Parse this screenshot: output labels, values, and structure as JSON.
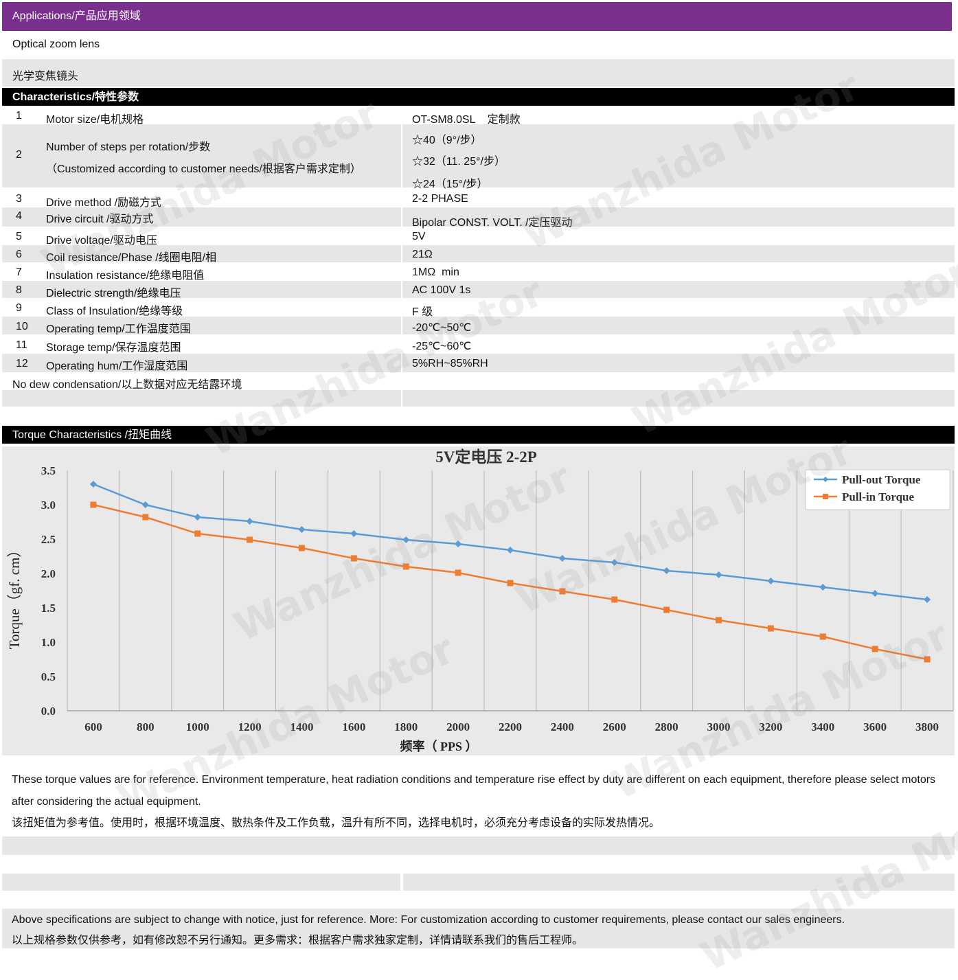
{
  "applications": {
    "header": "Applications/产品应用领域",
    "line_en": "Optical zoom lens",
    "line_cn": "光学变焦镜头"
  },
  "characteristics": {
    "header": "Characteristics/特性参数",
    "rows": [
      {
        "num": "1",
        "name": "Motor size/电机规格",
        "value": "OT-SM8.0SL    定制款"
      },
      {
        "num": "2",
        "name": "Number of steps per rotation/步数",
        "name2": "（Customized according to customer needs/根据客户需求定制）",
        "values": [
          "☆40（9°/步）",
          "☆32（11. 25°/步）",
          "☆24（15°/步）"
        ]
      },
      {
        "num": "3",
        "name": "Drive method /励磁方式",
        "value": "2-2 PHASE"
      },
      {
        "num": "4",
        "name": "Drive circuit /驱动方式",
        "value": "Bipolar CONST. VOLT. /定压驱动"
      },
      {
        "num": "5",
        "name": "Drive voltage/驱动电压",
        "value": "5V"
      },
      {
        "num": "6",
        "name": "Coil resistance/Phase /线圈电阻/相",
        "value": "21Ω"
      },
      {
        "num": "7",
        "name": "Insulation resistance/绝缘电阻值",
        "value": "1MΩ  min"
      },
      {
        "num": "8",
        "name": "Dielectric strength/绝缘电压",
        "value": "AC 100V 1s"
      },
      {
        "num": "9",
        "name": "Class of Insulation/绝缘等级",
        "value": "F 级"
      },
      {
        "num": "10",
        "name": "Operating temp/工作温度范围",
        "value": "-20℃~50℃"
      },
      {
        "num": "11",
        "name": "Storage temp/保存温度范围",
        "value": "-25℃~60℃"
      },
      {
        "num": "12",
        "name": "Operating hum/工作湿度范围",
        "value": "5%RH~85%RH"
      }
    ],
    "note": "No dew condensation/以上数据对应无结露环境"
  },
  "torque": {
    "header": "Torque Characteristics /扭矩曲线",
    "note_en": "These torque values are for reference. Environment temperature, heat radiation conditions and temperature rise effect by duty are different on each equipment, therefore please select motors after considering the actual equipment.",
    "note_cn": "该扭矩值为参考值。使用时，根据环境温度、散热条件及工作负载，温升有所不同，选择电机时，必须充分考虑设备的实际发热情况。"
  },
  "footer": {
    "en": "Above specifications are subject to change with notice, just for reference. More: For customization according to customer requirements, please contact our sales engineers.",
    "cn": "以上规格参数仅供参考，如有修改恕不另行通知。更多需求：根据客户需求独家定制，详情请联系我们的售后工程师。"
  },
  "watermark": "Wanzhida Motor",
  "chart_data": {
    "type": "line",
    "title": "5V定电压 2-2P",
    "xlabel": "频率（ PPS ）",
    "ylabel": "Torque（gf. cm）",
    "x": [
      600,
      800,
      1000,
      1200,
      1400,
      1600,
      1800,
      2000,
      2200,
      2400,
      2600,
      2800,
      3000,
      3200,
      3400,
      3600,
      3800
    ],
    "y_ticks": [
      "0.0",
      "0.5",
      "1.0",
      "1.5",
      "2.0",
      "2.5",
      "3.0",
      "3.5"
    ],
    "ylim": [
      0,
      3.5
    ],
    "legend_position": "top-right",
    "grid": "vertical",
    "series": [
      {
        "name": "Pull-out Torque",
        "color": "#5b9bd5",
        "marker": "diamond",
        "values": [
          3.3,
          3.0,
          2.82,
          2.76,
          2.64,
          2.58,
          2.49,
          2.43,
          2.34,
          2.22,
          2.16,
          2.04,
          1.98,
          1.89,
          1.8,
          1.71,
          1.62
        ]
      },
      {
        "name": "Pull-in Torque",
        "color": "#ed7d31",
        "marker": "square",
        "values": [
          3.0,
          2.82,
          2.58,
          2.49,
          2.37,
          2.22,
          2.1,
          2.01,
          1.86,
          1.74,
          1.62,
          1.47,
          1.32,
          1.2,
          1.08,
          0.9,
          0.75
        ]
      }
    ]
  }
}
